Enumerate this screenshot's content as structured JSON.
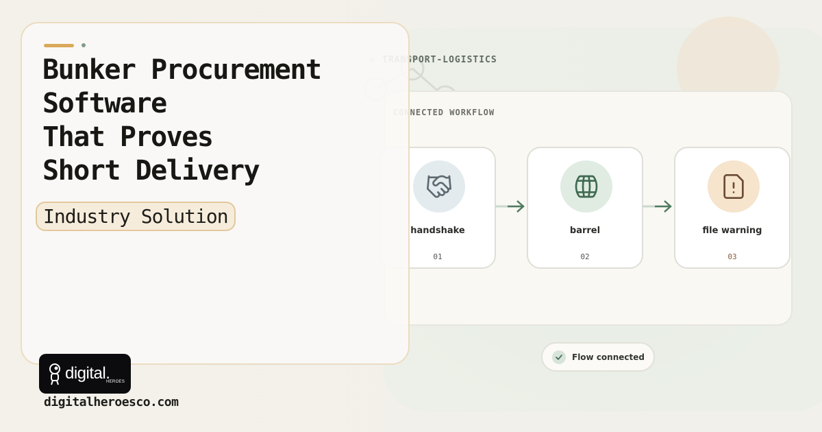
{
  "hero": {
    "title_lines": [
      "Bunker Procurement",
      "Software",
      "That Proves",
      "Short Delivery"
    ],
    "tag": "Industry Solution"
  },
  "eyebrow": "TRANSPORT-LOGISTICS",
  "workflow": {
    "label": "CONNECTED WORKFLOW",
    "steps": [
      {
        "name": "handshake",
        "number": "01",
        "icon": "handshake-icon",
        "icon_bg": "#e3ebef",
        "number_color": "#555555"
      },
      {
        "name": "barrel",
        "number": "02",
        "icon": "barrel-icon",
        "icon_bg": "#e0ece2",
        "number_color": "#555555"
      },
      {
        "name": "file warning",
        "number": "03",
        "icon": "file-warning-icon",
        "icon_bg": "#f6e4cc",
        "number_color": "#8a5a3a"
      }
    ],
    "status": "Flow connected"
  },
  "brand": {
    "logo_text": "digital.",
    "logo_sub": "HEROES",
    "site": "digitalheroesco.com"
  },
  "colors": {
    "accent_gold": "#d9a85a",
    "accent_green": "#4e7a5f"
  }
}
